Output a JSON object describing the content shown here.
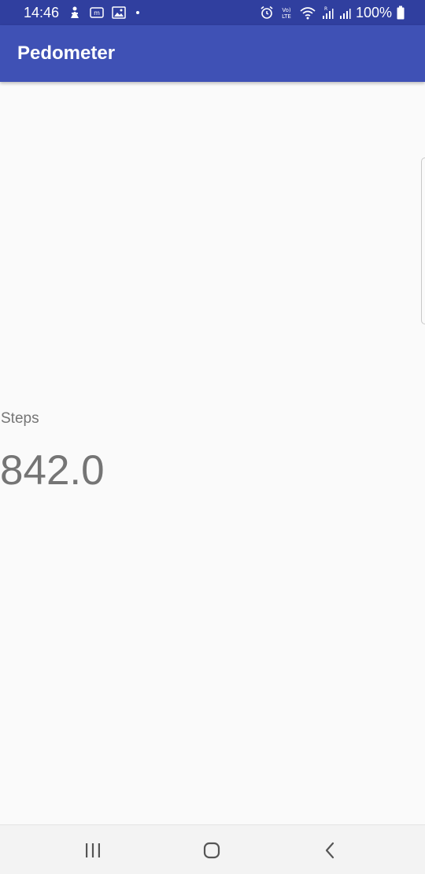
{
  "status_bar": {
    "time": "14:46",
    "battery_text": "100%",
    "left_icons": [
      "android-debug-icon",
      "messenger-icon",
      "gallery-icon",
      "dot-icon"
    ],
    "right_icons": [
      "alarm-icon",
      "volte-icon",
      "wifi-icon",
      "signal-roaming-icon",
      "signal-icon",
      "battery-icon"
    ]
  },
  "app_bar": {
    "title": "Pedometer"
  },
  "main": {
    "steps_label": "Steps",
    "steps_value": "842.0"
  },
  "nav_bar": {
    "buttons": [
      "recents-icon",
      "home-icon",
      "back-icon"
    ]
  },
  "colors": {
    "status_bar": "#303f9f",
    "app_bar": "#3f51b5",
    "background": "#fafafa",
    "text_secondary": "#757575"
  }
}
